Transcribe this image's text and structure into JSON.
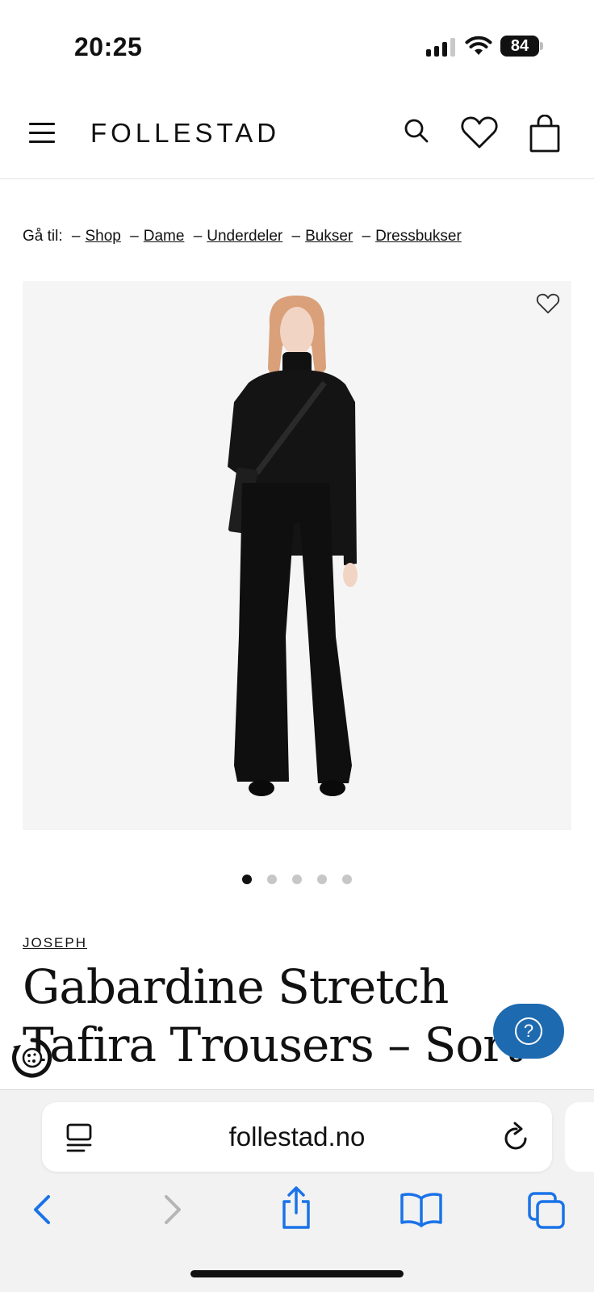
{
  "status": {
    "time": "20:25",
    "battery": "84"
  },
  "header": {
    "logo": "FOLLESTAD"
  },
  "breadcrumb": {
    "prefix": "Gå til:",
    "items": [
      "Shop",
      "Dame",
      "Underdeler",
      "Bukser",
      "Dressbukser"
    ]
  },
  "carousel": {
    "total": 5,
    "active_index": 0
  },
  "product": {
    "brand": "JOSEPH",
    "title": "Gabardine Stretch Tafira Trousers – Sort"
  },
  "help_button": {
    "label": "?"
  },
  "browser": {
    "url": "follestad.no"
  },
  "colors": {
    "accent_blue": "#1e6ab0",
    "ios_blue": "#1a73e8",
    "image_bg": "#f5f5f5"
  },
  "icons": [
    "menu-icon",
    "search-icon",
    "heart-icon",
    "bag-icon",
    "reader-icon",
    "reload-icon",
    "back-icon",
    "forward-icon",
    "share-icon",
    "bookmarks-icon",
    "tabs-icon",
    "cookie-icon"
  ]
}
